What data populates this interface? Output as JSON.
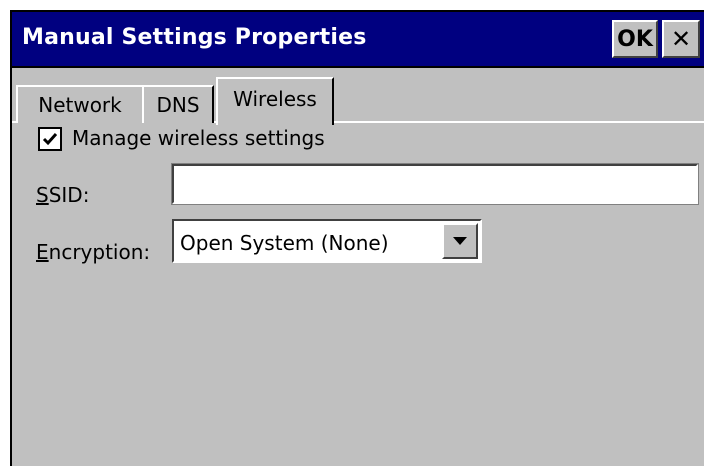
{
  "window": {
    "title": "Manual Settings Properties",
    "ok_label": "OK",
    "close_label": "✕"
  },
  "tabs": [
    {
      "label": "Network",
      "active": false
    },
    {
      "label": "DNS",
      "active": false
    },
    {
      "label": "Wireless",
      "active": true
    }
  ],
  "wireless": {
    "manage_checkbox": {
      "label": "Manage wireless settings",
      "checked": true
    },
    "ssid": {
      "label_first": "S",
      "label_rest": "SID:",
      "value": "",
      "placeholder": ""
    },
    "encryption": {
      "label_first": "E",
      "label_rest": "ncryption:",
      "selected": "Open System (None)"
    }
  },
  "colors": {
    "titlebar": "#000080",
    "face": "#c0c0c0",
    "field": "#ffffff"
  },
  "icons": {
    "check": "check-icon",
    "dropdown": "chevron-down-icon",
    "close": "close-icon"
  }
}
